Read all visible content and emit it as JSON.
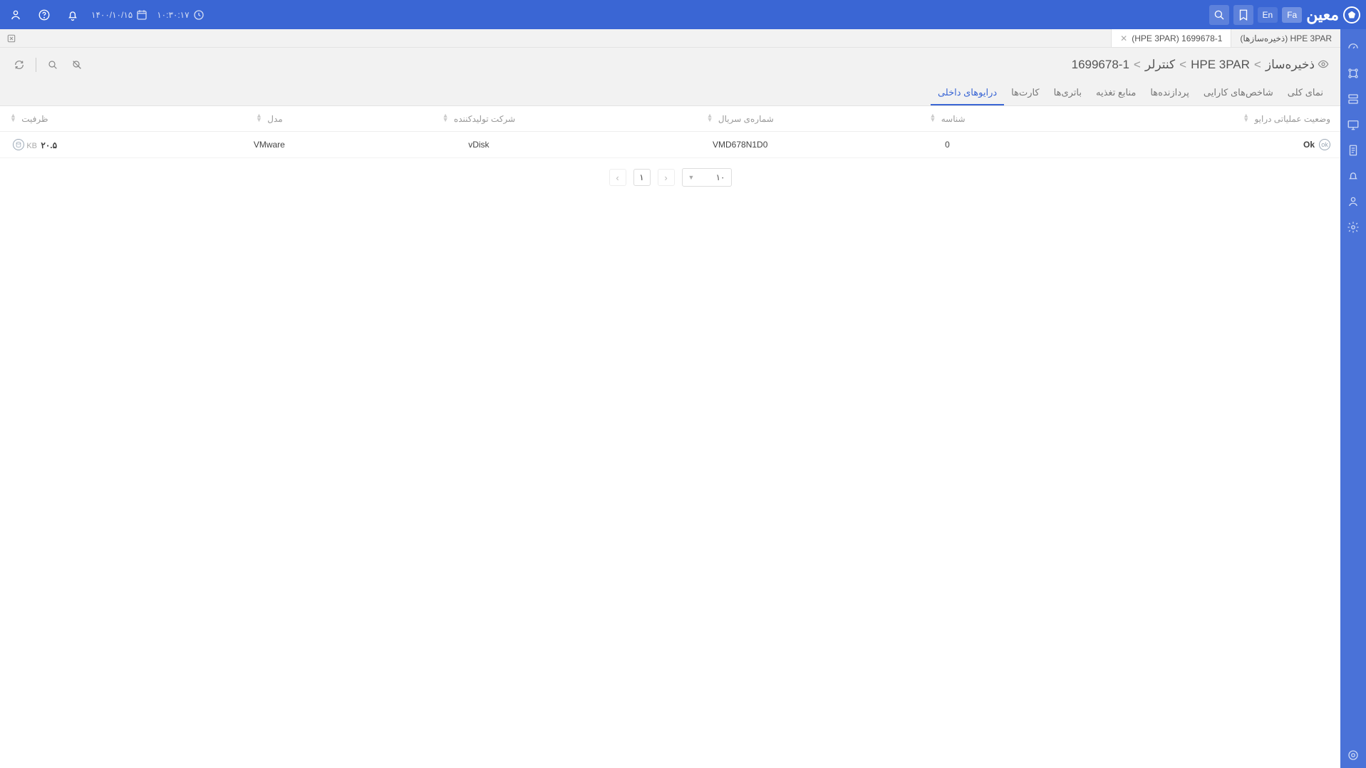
{
  "brand": "معین",
  "lang": {
    "en": "En",
    "fa": "Fa",
    "active": "fa"
  },
  "date": "۱۴۰۰/۱۰/۱۵",
  "time": "۱۰:۳۰:۱۷",
  "tabs": [
    {
      "label": "HPE 3PAR (ذخیره‌سازها)",
      "active": false
    },
    {
      "label": "1699678-1 (HPE 3PAR)",
      "active": true
    }
  ],
  "breadcrumb": {
    "parts": [
      "ذخیره‌ساز",
      "HPE 3PAR",
      "کنترلر",
      "1699678-1"
    ],
    "sep": ">"
  },
  "subtabs": [
    {
      "label": "نمای کلی"
    },
    {
      "label": "شاخص‌های کارایی"
    },
    {
      "label": "پردازنده‌ها"
    },
    {
      "label": "منابع تغذیه"
    },
    {
      "label": "باتری‌ها"
    },
    {
      "label": "کارت‌ها"
    },
    {
      "label": "درایوهای داخلی",
      "active": true
    }
  ],
  "columns": [
    {
      "key": "status",
      "label": "وضعیت عملیاتی درایو"
    },
    {
      "key": "id",
      "label": "شناسه"
    },
    {
      "key": "serial",
      "label": "شماره‌ی سریال"
    },
    {
      "key": "vendor",
      "label": "شرکت تولیدکننده"
    },
    {
      "key": "model",
      "label": "مدل"
    },
    {
      "key": "capacity",
      "label": "ظرفیت"
    }
  ],
  "rows": [
    {
      "status": "Ok",
      "id": "0",
      "serial": "VMD678N1D0",
      "vendor": "vDisk",
      "model": "VMware",
      "capacity_val": "۲۰.۵",
      "capacity_unit": "KB"
    }
  ],
  "pager": {
    "page_size": "۱۰",
    "page": "۱"
  }
}
